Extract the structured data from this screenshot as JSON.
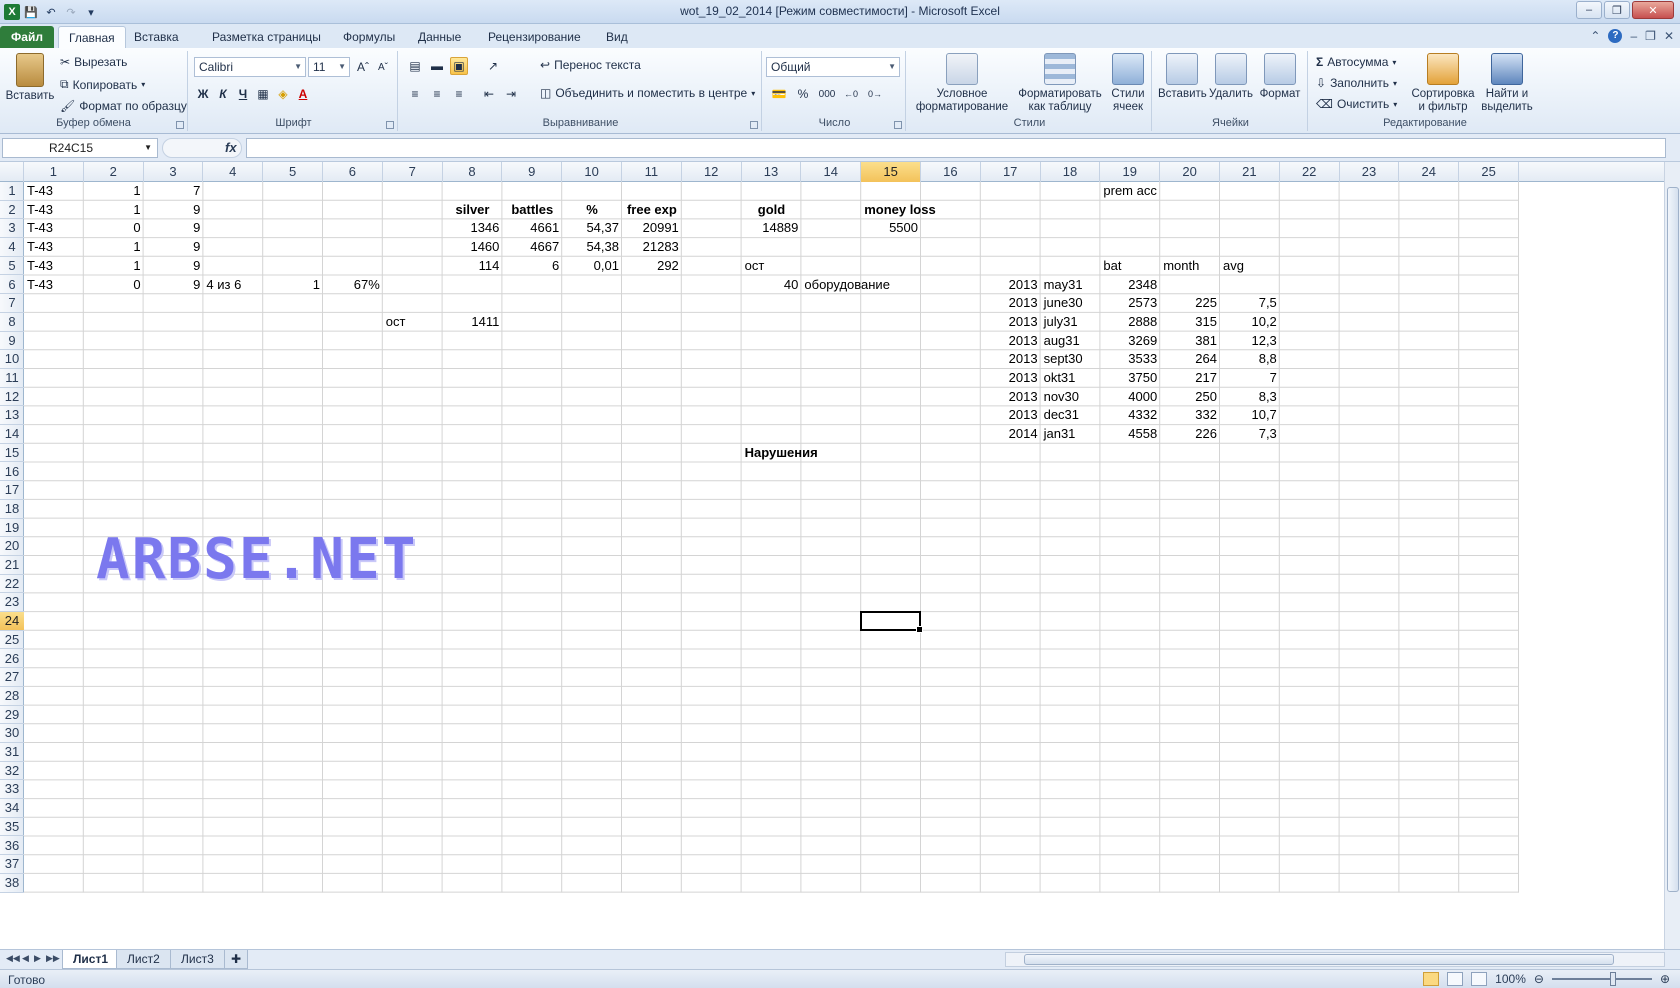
{
  "window": {
    "title": "wot_19_02_2014  [Режим совместимости]  -  Microsoft Excel",
    "app_icon": "X"
  },
  "ribbon_tabs": [
    "Файл",
    "Главная",
    "Вставка",
    "Разметка страницы",
    "Формулы",
    "Данные",
    "Рецензирование",
    "Вид"
  ],
  "ribbon": {
    "clipboard": {
      "label": "Буфер обмена",
      "paste": "Вставить",
      "cut": "Вырезать",
      "copy": "Копировать",
      "format_painter": "Формат по образцу"
    },
    "font": {
      "label": "Шрифт",
      "name": "Calibri",
      "size": "11",
      "bold": "Ж",
      "italic": "К",
      "underline": "Ч"
    },
    "alignment": {
      "label": "Выравнивание",
      "wrap": "Перенос текста",
      "merge": "Объединить и поместить в центре"
    },
    "number": {
      "label": "Число",
      "format": "Общий",
      "percent": "%",
      "thousands": "000"
    },
    "styles": {
      "label": "Стили",
      "cond_format_1": "Условное",
      "cond_format_2": "форматирование",
      "as_table_1": "Форматировать",
      "as_table_2": "как таблицу",
      "cell_styles_1": "Стили",
      "cell_styles_2": "ячеек"
    },
    "cells": {
      "label": "Ячейки",
      "insert": "Вставить",
      "delete": "Удалить",
      "format": "Формат"
    },
    "editing": {
      "label": "Редактирование",
      "autosum": "Автосумма",
      "fill": "Заполнить",
      "clear": "Очистить",
      "sort_1": "Сортировка",
      "sort_2": "и фильтр",
      "find_1": "Найти и",
      "find_2": "выделить"
    }
  },
  "formula_bar": {
    "name_box": "R24C15",
    "fx": "fx",
    "formula": ""
  },
  "columns": [
    "1",
    "2",
    "3",
    "4",
    "5",
    "6",
    "7",
    "8",
    "9",
    "10",
    "11",
    "12",
    "13",
    "14",
    "15",
    "16",
    "17",
    "18",
    "19",
    "20",
    "21",
    "22",
    "23",
    "24",
    "25"
  ],
  "rows": [
    "1",
    "2",
    "3",
    "4",
    "5",
    "6",
    "7",
    "8",
    "9",
    "10",
    "11",
    "12",
    "13",
    "14",
    "15",
    "16",
    "17",
    "18",
    "19",
    "20",
    "21",
    "22",
    "23",
    "24",
    "25",
    "26",
    "27",
    "28",
    "29",
    "30",
    "31",
    "32",
    "33",
    "34",
    "35",
    "36",
    "37",
    "38"
  ],
  "selected_cell": {
    "row": 24,
    "col": 15
  },
  "cells": [
    {
      "r": 1,
      "c": 1,
      "v": "T-43",
      "a": "l"
    },
    {
      "r": 1,
      "c": 2,
      "v": "1",
      "a": "r"
    },
    {
      "r": 1,
      "c": 3,
      "v": "7",
      "a": "r"
    },
    {
      "r": 1,
      "c": 19,
      "v": "prem acc",
      "a": "l"
    },
    {
      "r": 2,
      "c": 1,
      "v": "T-43",
      "a": "l"
    },
    {
      "r": 2,
      "c": 2,
      "v": "1",
      "a": "r"
    },
    {
      "r": 2,
      "c": 3,
      "v": "9",
      "a": "r"
    },
    {
      "r": 2,
      "c": 8,
      "v": "silver",
      "a": "c",
      "b": true
    },
    {
      "r": 2,
      "c": 9,
      "v": "battles",
      "a": "c",
      "b": true
    },
    {
      "r": 2,
      "c": 10,
      "v": "%",
      "a": "c",
      "b": true
    },
    {
      "r": 2,
      "c": 11,
      "v": "free exp",
      "a": "c",
      "b": true
    },
    {
      "r": 2,
      "c": 13,
      "v": "gold",
      "a": "c",
      "b": true
    },
    {
      "r": 2,
      "c": 15,
      "v": "money loss",
      "a": "c",
      "b": true
    },
    {
      "r": 3,
      "c": 1,
      "v": "T-43",
      "a": "l"
    },
    {
      "r": 3,
      "c": 2,
      "v": "0",
      "a": "r"
    },
    {
      "r": 3,
      "c": 3,
      "v": "9",
      "a": "r"
    },
    {
      "r": 3,
      "c": 8,
      "v": "1346",
      "a": "r"
    },
    {
      "r": 3,
      "c": 9,
      "v": "4661",
      "a": "r"
    },
    {
      "r": 3,
      "c": 10,
      "v": "54,37",
      "a": "r"
    },
    {
      "r": 3,
      "c": 11,
      "v": "20991",
      "a": "r"
    },
    {
      "r": 3,
      "c": 13,
      "v": "14889",
      "a": "r"
    },
    {
      "r": 3,
      "c": 15,
      "v": "5500",
      "a": "r"
    },
    {
      "r": 4,
      "c": 1,
      "v": "T-43",
      "a": "l"
    },
    {
      "r": 4,
      "c": 2,
      "v": "1",
      "a": "r"
    },
    {
      "r": 4,
      "c": 3,
      "v": "9",
      "a": "r"
    },
    {
      "r": 4,
      "c": 8,
      "v": "1460",
      "a": "r"
    },
    {
      "r": 4,
      "c": 9,
      "v": "4667",
      "a": "r"
    },
    {
      "r": 4,
      "c": 10,
      "v": "54,38",
      "a": "r"
    },
    {
      "r": 4,
      "c": 11,
      "v": "21283",
      "a": "r"
    },
    {
      "r": 5,
      "c": 1,
      "v": "T-43",
      "a": "l"
    },
    {
      "r": 5,
      "c": 2,
      "v": "1",
      "a": "r"
    },
    {
      "r": 5,
      "c": 3,
      "v": "9",
      "a": "r"
    },
    {
      "r": 5,
      "c": 8,
      "v": "114",
      "a": "r"
    },
    {
      "r": 5,
      "c": 9,
      "v": "6",
      "a": "r"
    },
    {
      "r": 5,
      "c": 10,
      "v": "0,01",
      "a": "r"
    },
    {
      "r": 5,
      "c": 11,
      "v": "292",
      "a": "r"
    },
    {
      "r": 5,
      "c": 13,
      "v": "ост",
      "a": "l"
    },
    {
      "r": 5,
      "c": 19,
      "v": "bat",
      "a": "l"
    },
    {
      "r": 5,
      "c": 20,
      "v": "month",
      "a": "l"
    },
    {
      "r": 5,
      "c": 21,
      "v": "avg",
      "a": "l"
    },
    {
      "r": 6,
      "c": 1,
      "v": "T-43",
      "a": "l"
    },
    {
      "r": 6,
      "c": 2,
      "v": "0",
      "a": "r"
    },
    {
      "r": 6,
      "c": 3,
      "v": "9",
      "a": "r"
    },
    {
      "r": 6,
      "c": 4,
      "v": "4 из 6",
      "a": "l"
    },
    {
      "r": 6,
      "c": 5,
      "v": "1",
      "a": "r"
    },
    {
      "r": 6,
      "c": 6,
      "v": "67%",
      "a": "r"
    },
    {
      "r": 6,
      "c": 13,
      "v": "40",
      "a": "r"
    },
    {
      "r": 6,
      "c": 14,
      "v": "оборудование",
      "a": "l"
    },
    {
      "r": 6,
      "c": 17,
      "v": "2013",
      "a": "r"
    },
    {
      "r": 6,
      "c": 18,
      "v": "may31",
      "a": "l"
    },
    {
      "r": 6,
      "c": 19,
      "v": "2348",
      "a": "r"
    },
    {
      "r": 7,
      "c": 17,
      "v": "2013",
      "a": "r"
    },
    {
      "r": 7,
      "c": 18,
      "v": "june30",
      "a": "l"
    },
    {
      "r": 7,
      "c": 19,
      "v": "2573",
      "a": "r"
    },
    {
      "r": 7,
      "c": 20,
      "v": "225",
      "a": "r"
    },
    {
      "r": 7,
      "c": 21,
      "v": "7,5",
      "a": "r"
    },
    {
      "r": 8,
      "c": 7,
      "v": "ост",
      "a": "l"
    },
    {
      "r": 8,
      "c": 8,
      "v": "1411",
      "a": "r"
    },
    {
      "r": 8,
      "c": 17,
      "v": "2013",
      "a": "r"
    },
    {
      "r": 8,
      "c": 18,
      "v": "july31",
      "a": "l"
    },
    {
      "r": 8,
      "c": 19,
      "v": "2888",
      "a": "r"
    },
    {
      "r": 8,
      "c": 20,
      "v": "315",
      "a": "r"
    },
    {
      "r": 8,
      "c": 21,
      "v": "10,2",
      "a": "r"
    },
    {
      "r": 9,
      "c": 17,
      "v": "2013",
      "a": "r"
    },
    {
      "r": 9,
      "c": 18,
      "v": "aug31",
      "a": "l"
    },
    {
      "r": 9,
      "c": 19,
      "v": "3269",
      "a": "r"
    },
    {
      "r": 9,
      "c": 20,
      "v": "381",
      "a": "r"
    },
    {
      "r": 9,
      "c": 21,
      "v": "12,3",
      "a": "r"
    },
    {
      "r": 10,
      "c": 17,
      "v": "2013",
      "a": "r"
    },
    {
      "r": 10,
      "c": 18,
      "v": "sept30",
      "a": "l"
    },
    {
      "r": 10,
      "c": 19,
      "v": "3533",
      "a": "r"
    },
    {
      "r": 10,
      "c": 20,
      "v": "264",
      "a": "r"
    },
    {
      "r": 10,
      "c": 21,
      "v": "8,8",
      "a": "r"
    },
    {
      "r": 11,
      "c": 17,
      "v": "2013",
      "a": "r"
    },
    {
      "r": 11,
      "c": 18,
      "v": "okt31",
      "a": "l"
    },
    {
      "r": 11,
      "c": 19,
      "v": "3750",
      "a": "r"
    },
    {
      "r": 11,
      "c": 20,
      "v": "217",
      "a": "r"
    },
    {
      "r": 11,
      "c": 21,
      "v": "7",
      "a": "r"
    },
    {
      "r": 12,
      "c": 17,
      "v": "2013",
      "a": "r"
    },
    {
      "r": 12,
      "c": 18,
      "v": "nov30",
      "a": "l"
    },
    {
      "r": 12,
      "c": 19,
      "v": "4000",
      "a": "r"
    },
    {
      "r": 12,
      "c": 20,
      "v": "250",
      "a": "r"
    },
    {
      "r": 12,
      "c": 21,
      "v": "8,3",
      "a": "r"
    },
    {
      "r": 13,
      "c": 17,
      "v": "2013",
      "a": "r"
    },
    {
      "r": 13,
      "c": 18,
      "v": "dec31",
      "a": "l"
    },
    {
      "r": 13,
      "c": 19,
      "v": "4332",
      "a": "r"
    },
    {
      "r": 13,
      "c": 20,
      "v": "332",
      "a": "r"
    },
    {
      "r": 13,
      "c": 21,
      "v": "10,7",
      "a": "r"
    },
    {
      "r": 14,
      "c": 17,
      "v": "2014",
      "a": "r"
    },
    {
      "r": 14,
      "c": 18,
      "v": "jan31",
      "a": "l"
    },
    {
      "r": 14,
      "c": 19,
      "v": "4558",
      "a": "r"
    },
    {
      "r": 14,
      "c": 20,
      "v": "226",
      "a": "r"
    },
    {
      "r": 14,
      "c": 21,
      "v": "7,3",
      "a": "r"
    },
    {
      "r": 15,
      "c": 13,
      "v": "Нарушения",
      "a": "l",
      "b": true
    }
  ],
  "watermark": "ARBSE.NET",
  "sheets": [
    "Лист1",
    "Лист2",
    "Лист3"
  ],
  "status": {
    "ready": "Готово",
    "zoom": "100%"
  },
  "colors": {
    "file_tab": "#2f7d3b",
    "selection_header": "#f3c25a",
    "watermark": "#7b78ee"
  }
}
